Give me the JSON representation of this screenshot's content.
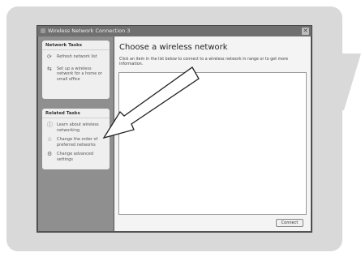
{
  "window": {
    "title": "Wireless Network Connection 3",
    "close_glyph": "✕"
  },
  "sidebar": {
    "network_tasks": {
      "title": "Network Tasks",
      "items": [
        {
          "label": "Refresh network list",
          "icon": "refresh-icon"
        },
        {
          "label": "Set up a wireless network for a home or small office",
          "icon": "setup-network-icon"
        }
      ]
    },
    "related_tasks": {
      "title": "Related Tasks",
      "items": [
        {
          "label": "Learn about wireless networking",
          "icon": "info-icon"
        },
        {
          "label": "Change the order of preferred networks",
          "icon": "star-icon"
        },
        {
          "label": "Change advanced settings",
          "icon": "settings-icon"
        }
      ]
    }
  },
  "main": {
    "title": "Choose a wireless network",
    "description": "Click an item in the list below to connect to a wireless network in range or to get more information.",
    "connect_label": "Connect"
  },
  "colors": {
    "frame": "#d9d9d9",
    "sidebar": "#8f8f8f",
    "panel": "#efefef"
  }
}
